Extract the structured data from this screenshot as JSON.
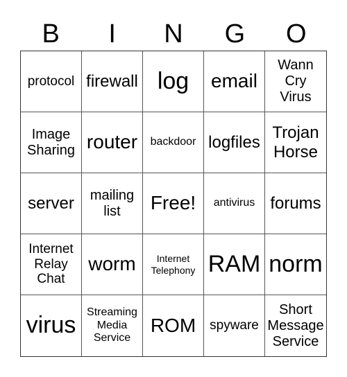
{
  "header": [
    "B",
    "I",
    "N",
    "G",
    "O"
  ],
  "cells": [
    [
      "protocol",
      "firewall",
      "log",
      "email",
      "Wann\nCry\nVirus"
    ],
    [
      "Image\nSharing",
      "router",
      "backdoor",
      "logfiles",
      "Trojan\nHorse"
    ],
    [
      "server",
      "mailing\nlist",
      "Free!",
      "antivirus",
      "forums"
    ],
    [
      "Internet\nRelay\nChat",
      "worm",
      "Internet\nTelephony",
      "RAM",
      "norm"
    ],
    [
      "virus",
      "Streaming\nMedia\nService",
      "ROM",
      "spyware",
      "Short\nMessage\nService"
    ]
  ],
  "free_space": "Free!"
}
